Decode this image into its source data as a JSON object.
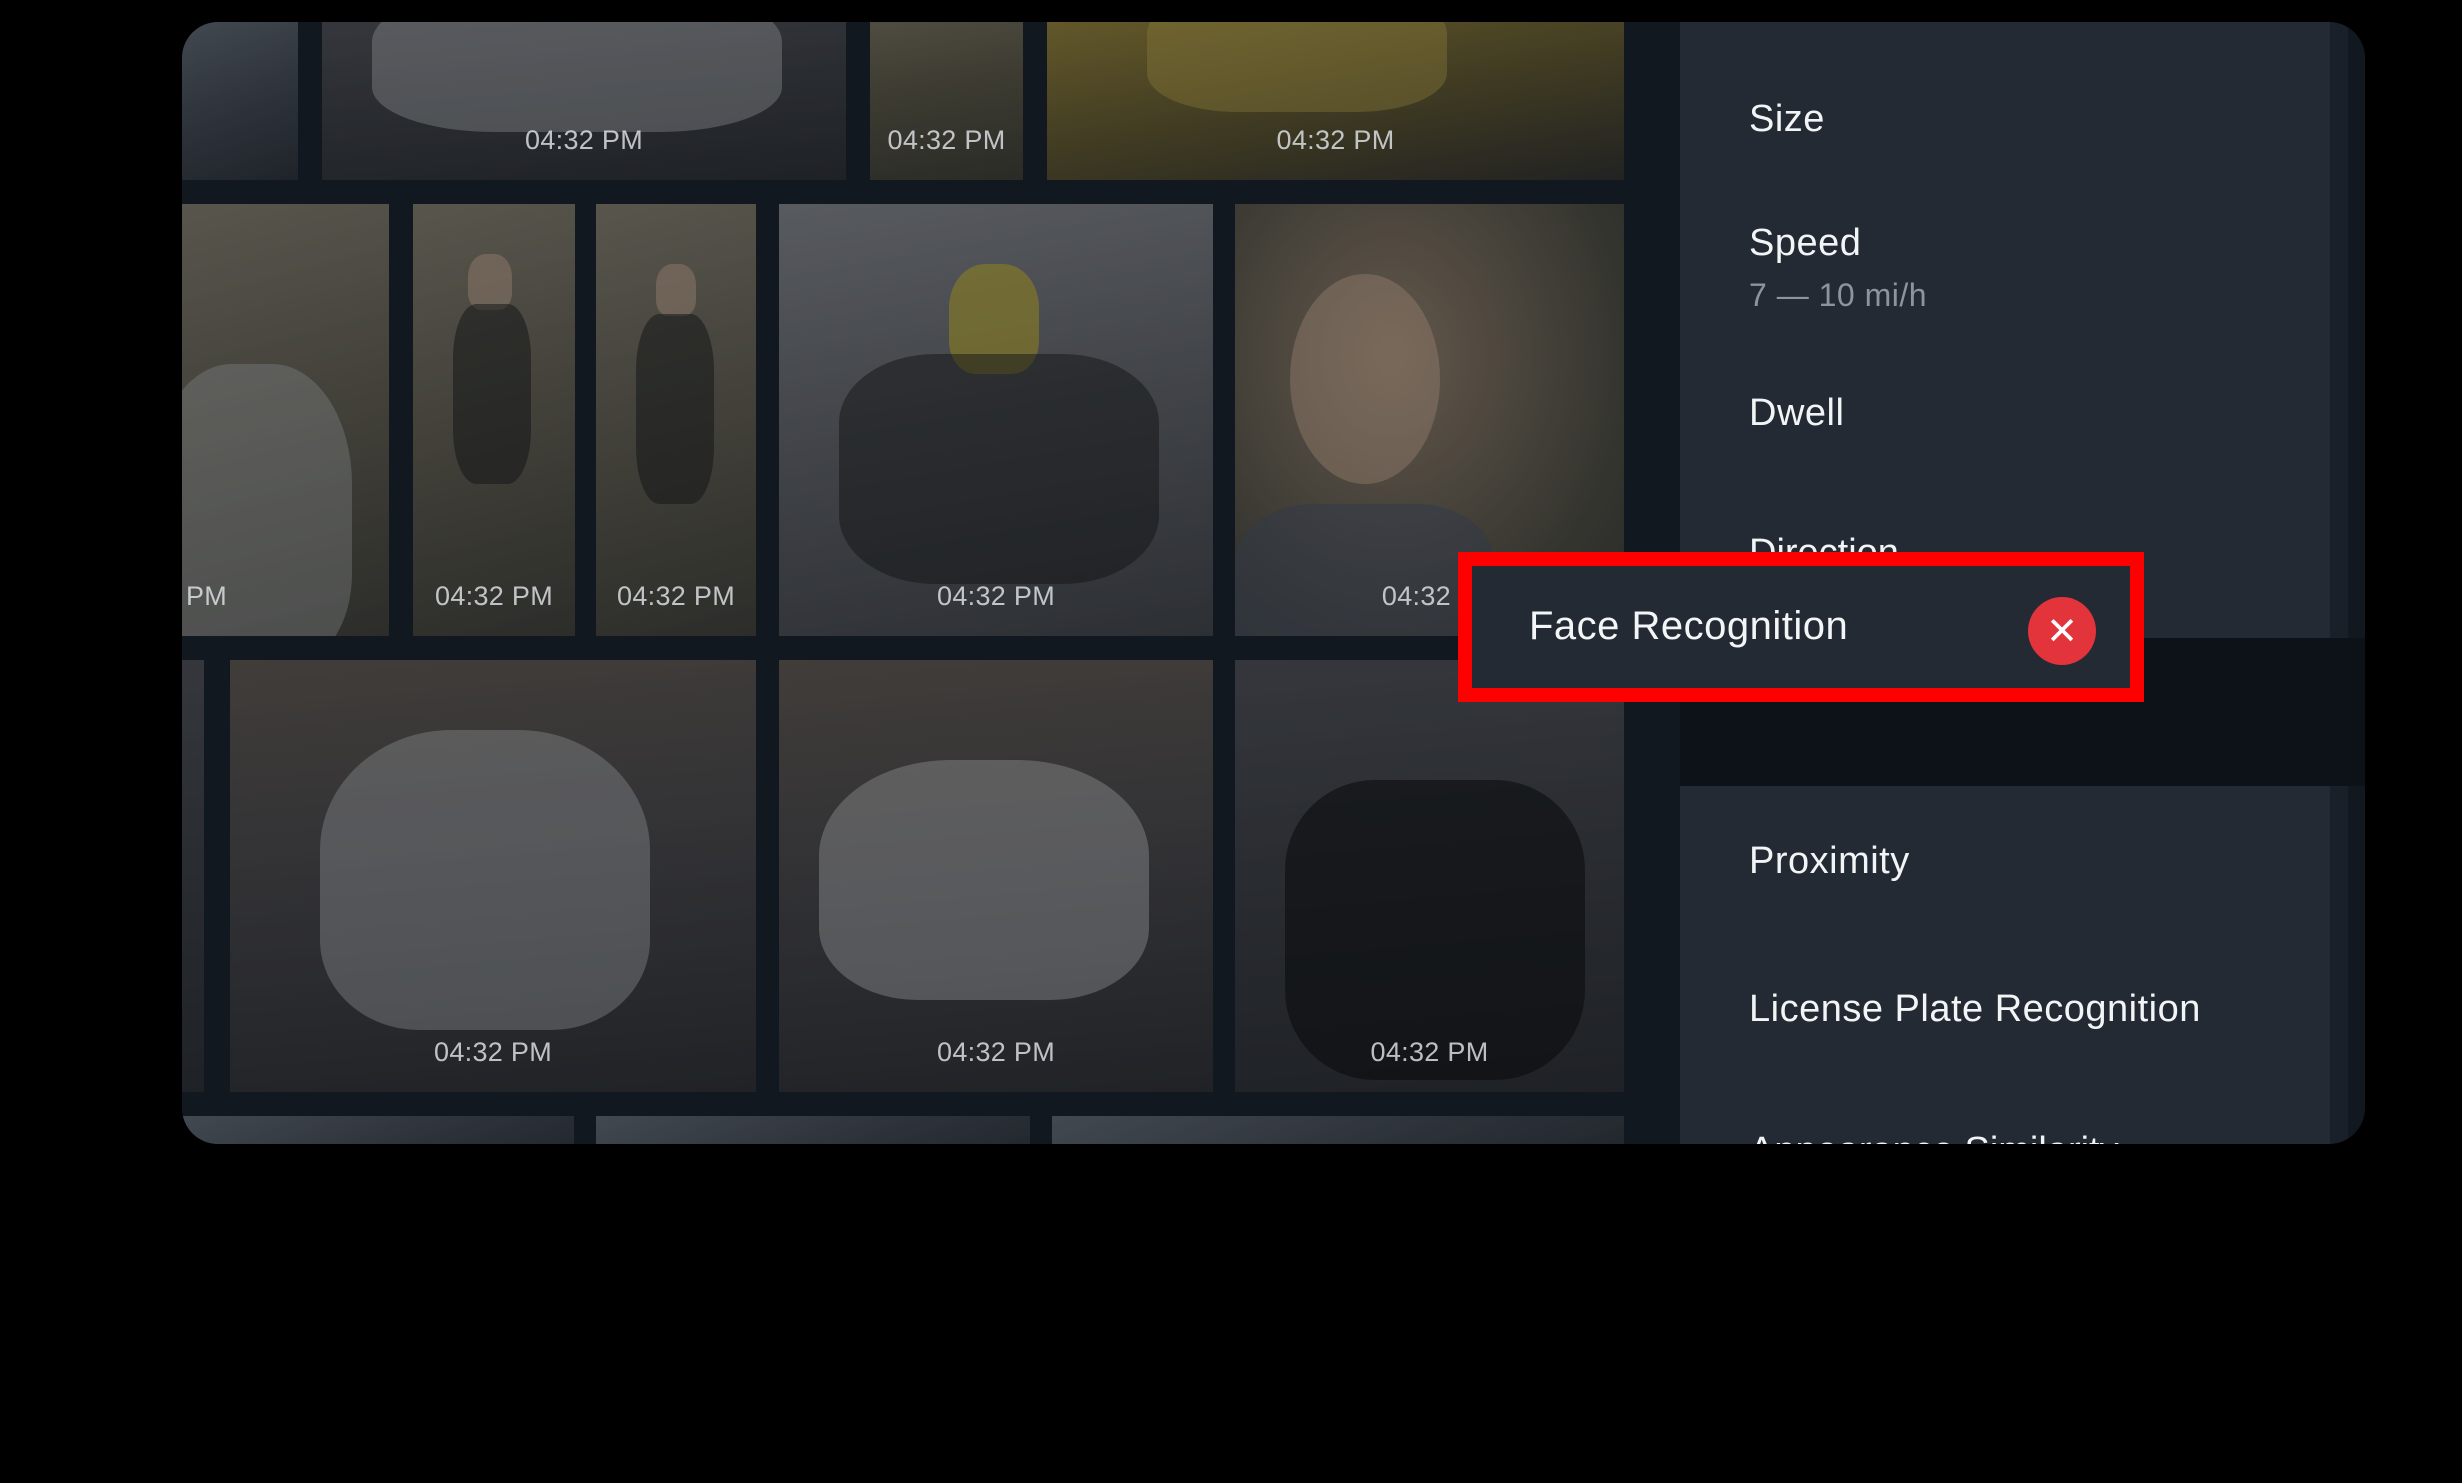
{
  "grid": {
    "timestamps": {
      "r1c1": "04:32 PM",
      "r1c2": "04:32 PM",
      "r1c3": "04:32 PM",
      "r2c0": "PM",
      "r2c1": "04:32 PM",
      "r2c2": "04:32 PM",
      "r2c3": "04:32 PM",
      "r2c4": "04:32 P",
      "r3c1": "04:32 PM",
      "r3c2": "04:32 PM",
      "r3c3": "04:32 PM"
    }
  },
  "filters": {
    "size": "Size",
    "speed": "Speed",
    "speed_range": "7 — 10 mi/h",
    "dwell": "Dwell",
    "direction_partial": "Direction",
    "face_recognition": "Face Recognition",
    "remove_symbol": "✕",
    "proximity": "Proximity",
    "license_plate": "License Plate Recognition",
    "appearance_partial": "Appearance Similarity"
  },
  "colors": {
    "highlight": "#ff0000",
    "remove_button": "#e3343b",
    "panel_bg": "#232a34",
    "grid_bg": "#121820"
  }
}
